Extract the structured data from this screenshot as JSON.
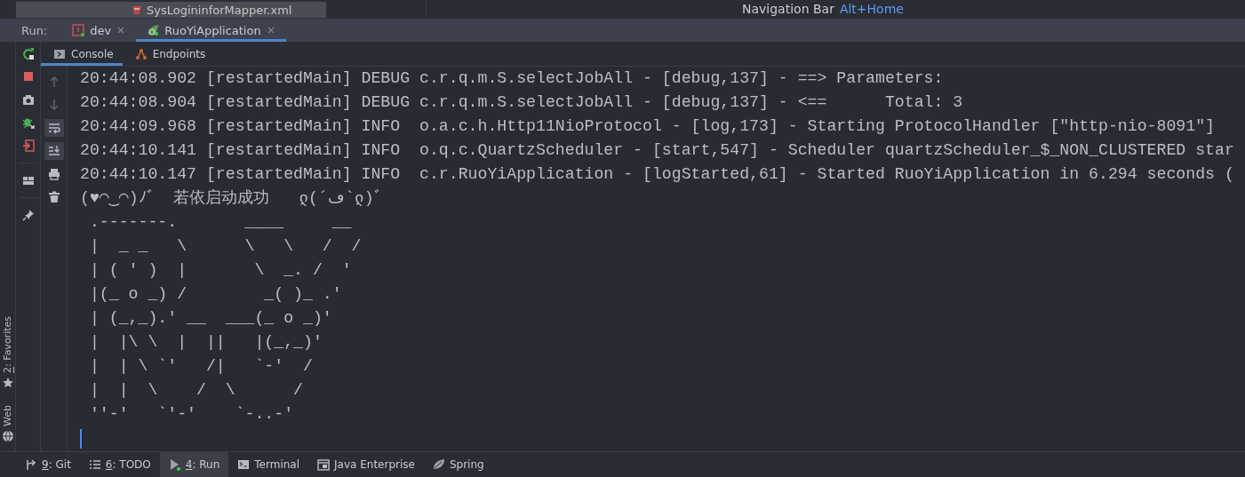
{
  "project_tree": {
    "row": {
      "label": "SysLogininforMapper.xml",
      "selected": true
    }
  },
  "navigation_hint": {
    "label": "Navigation Bar",
    "shortcut": "Alt+Home"
  },
  "run_bar": {
    "label": "Run:",
    "tabs": [
      {
        "label": "dev",
        "kind": "terminal",
        "selected": false
      },
      {
        "label": "RuoYiApplication",
        "kind": "spring",
        "selected": true
      }
    ]
  },
  "console_tabs": [
    {
      "label": "Console",
      "kind": "console",
      "selected": true
    },
    {
      "label": "Endpoints",
      "kind": "endpoints",
      "selected": false
    }
  ],
  "console_lines": [
    "20:44:08.902 [restartedMain] DEBUG c.r.q.m.S.selectJobAll - [debug,137] - ==> Parameters:",
    "20:44:08.904 [restartedMain] DEBUG c.r.q.m.S.selectJobAll - [debug,137] - <==      Total: 3",
    "20:44:09.968 [restartedMain] INFO  o.a.c.h.Http11NioProtocol - [log,173] - Starting ProtocolHandler [\"http-nio-8091\"]",
    "20:44:10.141 [restartedMain] INFO  o.q.c.QuartzScheduler - [start,547] - Scheduler quartzScheduler_$_NON_CLUSTERED star",
    "20:44:10.147 [restartedMain] INFO  c.r.RuoYiApplication - [logStarted,61] - Started RuoYiApplication in 6.294 seconds (",
    "(♥◠‿◠)ﾉﾞ  若依启动成功   ლ(´ڡ`ლ)ﾞ",
    " .-------.       ____     __",
    " |  _ _   \\      \\   \\   /  /",
    " | ( ' )  |       \\  _. /  '",
    " |(_ o _) /        _( )_ .'",
    " | (_,_).' __  ___(_ o _)'",
    " |  |\\ \\  |  ||   |(_,_)'",
    " |  | \\ `'   /|   `-'  /",
    " |  |  \\    /  \\      /",
    " ''-'   `'-'    `-..-'"
  ],
  "side_tools": [
    {
      "mnemonic": "2",
      "label": ": Favorites",
      "kind": "favorites"
    },
    {
      "label": "Web",
      "kind": "web"
    }
  ],
  "bottom_tools": [
    {
      "mnemonic": "9",
      "label": ": Git",
      "kind": "git",
      "selected": false
    },
    {
      "mnemonic": "6",
      "label": ": TODO",
      "kind": "todo",
      "selected": false
    },
    {
      "mnemonic": "4",
      "label": ": Run",
      "kind": "run",
      "selected": true
    },
    {
      "label": "Terminal",
      "kind": "terminal",
      "selected": false
    },
    {
      "label": "Java Enterprise",
      "kind": "enterprise",
      "selected": false
    },
    {
      "label": "Spring",
      "kind": "spring",
      "selected": false
    }
  ]
}
